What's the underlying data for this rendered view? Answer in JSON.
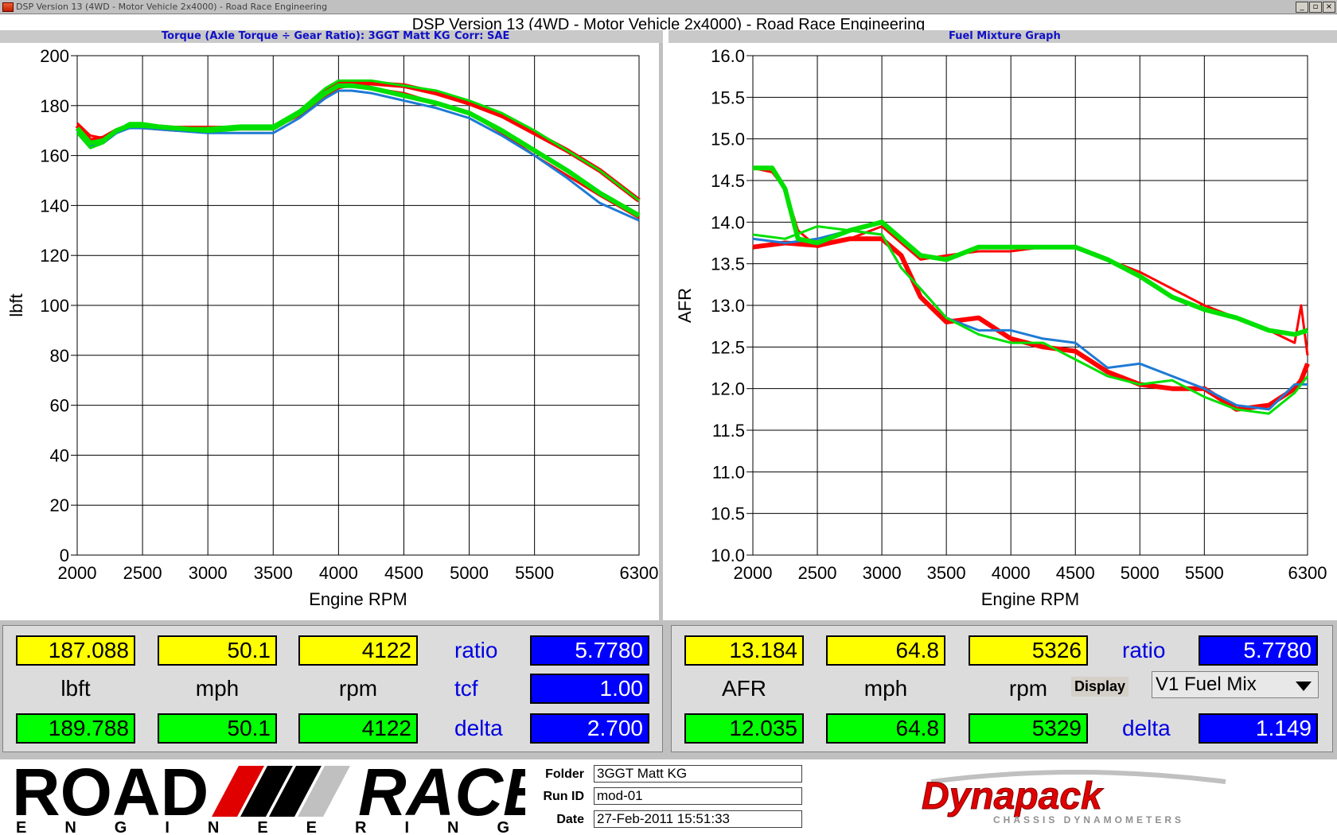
{
  "window": {
    "title": "DSP Version 13 (4WD - Motor Vehicle 2x4000) - Road Race Engineering",
    "app_title": "DSP Version 13 (4WD - Motor Vehicle 2x4000) - Road Race Engineering",
    "controls": [
      "_",
      "▫",
      "×"
    ]
  },
  "left_chart": {
    "header_title": "Torque (Axle Torque ÷ Gear Ratio): 3GGT Matt KG",
    "header_corr": "Corr: SAE",
    "xlabel": "Engine RPM",
    "ylabel": "lbft"
  },
  "right_chart": {
    "header_title": "Fuel Mixture Graph",
    "xlabel": "Engine RPM",
    "ylabel": "AFR"
  },
  "chart_data": [
    {
      "type": "line",
      "title": "Torque (Axle Torque ÷ Gear Ratio): 3GGT Matt KG",
      "xlabel": "Engine RPM",
      "ylabel": "lbft",
      "xlim": [
        2000,
        6300
      ],
      "ylim": [
        0,
        200
      ],
      "xticks": [
        "2000",
        "2500",
        "3000",
        "3500",
        "4000",
        "4500",
        "5000",
        "5500",
        "6300"
      ],
      "yticks": [
        "0",
        "20",
        "40",
        "60",
        "80",
        "100",
        "120",
        "140",
        "160",
        "180",
        "200"
      ],
      "grid": true,
      "series": [
        {
          "color": "#ff0000",
          "x": [
            2000,
            2100,
            2200,
            2300,
            2400,
            2500,
            2750,
            3000,
            3250,
            3500,
            3700,
            3900,
            4000,
            4100,
            4250,
            4500,
            4750,
            5000,
            5250,
            5500,
            5750,
            6000,
            6300
          ],
          "y": [
            173,
            168,
            167,
            170,
            172,
            171,
            170,
            170,
            171,
            171,
            176,
            184,
            187,
            188,
            187,
            185,
            181,
            177,
            169,
            160,
            152,
            144,
            135
          ]
        },
        {
          "color": "#ff0000",
          "x": [
            2000,
            2100,
            2200,
            2300,
            2400,
            2500,
            2750,
            3000,
            3250,
            3500,
            3700,
            3900,
            4000,
            4100,
            4250,
            4500,
            4750,
            5000,
            5250,
            5500,
            5750,
            6000,
            6300
          ],
          "y": [
            172,
            166,
            167,
            170,
            172,
            172,
            171,
            171,
            171,
            171,
            177,
            186,
            189,
            189,
            189,
            188,
            185,
            181,
            176,
            169,
            162,
            154,
            142
          ]
        },
        {
          "color": "#1e7ad4",
          "x": [
            2000,
            2100,
            2200,
            2300,
            2400,
            2500,
            2750,
            3000,
            3250,
            3500,
            3700,
            3900,
            4000,
            4100,
            4250,
            4500,
            4750,
            5000,
            5250,
            5500,
            5750,
            6000,
            6300
          ],
          "y": [
            170,
            164,
            165,
            169,
            171,
            171,
            170,
            169,
            169,
            169,
            175,
            183,
            186,
            186,
            185,
            182,
            179,
            175,
            168,
            160,
            151,
            141,
            134
          ]
        },
        {
          "color": "#00e000",
          "x": [
            2000,
            2100,
            2200,
            2300,
            2400,
            2500,
            2750,
            3000,
            3250,
            3500,
            3700,
            3900,
            4000,
            4100,
            4250,
            4500,
            4750,
            5000,
            5250,
            5500,
            5750,
            6000,
            6300
          ],
          "y": [
            171,
            165,
            166,
            170,
            172,
            172,
            171,
            170,
            171,
            171,
            177,
            185,
            188,
            188,
            187,
            184,
            181,
            177,
            170,
            162,
            154,
            145,
            136
          ]
        },
        {
          "color": "#00e000",
          "x": [
            2000,
            2100,
            2200,
            2300,
            2400,
            2500,
            2750,
            3000,
            3250,
            3500,
            3700,
            3900,
            4000,
            4100,
            4250,
            4500,
            4750,
            5000,
            5250,
            5500,
            5750,
            6000,
            6300
          ],
          "y": [
            169,
            163,
            165,
            170,
            173,
            173,
            171,
            171,
            172,
            172,
            178,
            187,
            190,
            190,
            190,
            188,
            186,
            182,
            177,
            170,
            162,
            154,
            142
          ]
        }
      ]
    },
    {
      "type": "line",
      "title": "Fuel Mixture Graph",
      "xlabel": "Engine RPM",
      "ylabel": "AFR",
      "xlim": [
        2000,
        6300
      ],
      "ylim": [
        10.0,
        16.0
      ],
      "xticks": [
        "2000",
        "2500",
        "3000",
        "3500",
        "4000",
        "4500",
        "5000",
        "5500",
        "6300"
      ],
      "yticks": [
        "10.0",
        "10.5",
        "11.0",
        "11.5",
        "12.0",
        "12.5",
        "13.0",
        "13.5",
        "14.0",
        "14.5",
        "15.0",
        "15.5",
        "16.0"
      ],
      "grid": true,
      "series": [
        {
          "color": "#ff0000",
          "x": [
            2000,
            2150,
            2250,
            2350,
            2500,
            2750,
            3000,
            3150,
            3300,
            3500,
            3750,
            4000,
            4250,
            4500,
            4750,
            5000,
            5250,
            5500,
            5750,
            6000,
            6200,
            6250,
            6300
          ],
          "y": [
            14.65,
            14.6,
            14.4,
            13.9,
            13.7,
            13.8,
            13.95,
            13.75,
            13.55,
            13.6,
            13.65,
            13.65,
            13.7,
            13.7,
            13.55,
            13.4,
            13.2,
            13.0,
            12.85,
            12.7,
            12.55,
            13.0,
            12.4
          ]
        },
        {
          "color": "#ff0000",
          "x": [
            2000,
            2250,
            2500,
            2750,
            3000,
            3150,
            3300,
            3500,
            3750,
            4000,
            4250,
            4500,
            4750,
            5000,
            5250,
            5500,
            5750,
            6000,
            6200,
            6250,
            6300
          ],
          "y": [
            13.7,
            13.75,
            13.72,
            13.8,
            13.8,
            13.6,
            13.1,
            12.8,
            12.85,
            12.6,
            12.5,
            12.45,
            12.2,
            12.05,
            12.0,
            12.0,
            11.75,
            11.8,
            12.0,
            12.1,
            12.3
          ]
        },
        {
          "color": "#1e7ad4",
          "x": [
            2000,
            2250,
            2500,
            2750,
            3000,
            3150,
            3300,
            3500,
            3750,
            4000,
            4250,
            4500,
            4750,
            5000,
            5250,
            5500,
            5750,
            6000,
            6200,
            6300
          ],
          "y": [
            13.8,
            13.75,
            13.8,
            13.9,
            13.85,
            13.45,
            13.2,
            12.85,
            12.7,
            12.7,
            12.6,
            12.55,
            12.25,
            12.3,
            12.15,
            12.0,
            11.8,
            11.75,
            12.05,
            12.05
          ]
        },
        {
          "color": "#00e000",
          "x": [
            2000,
            2150,
            2250,
            2350,
            2500,
            2750,
            3000,
            3150,
            3300,
            3500,
            3750,
            4000,
            4250,
            4500,
            4750,
            5000,
            5250,
            5500,
            5750,
            6000,
            6200,
            6300
          ],
          "y": [
            14.65,
            14.65,
            14.4,
            13.8,
            13.75,
            13.9,
            14.0,
            13.8,
            13.6,
            13.55,
            13.7,
            13.7,
            13.7,
            13.7,
            13.55,
            13.35,
            13.1,
            12.95,
            12.85,
            12.7,
            12.65,
            12.7
          ]
        },
        {
          "color": "#00e000",
          "x": [
            2000,
            2250,
            2500,
            2750,
            3000,
            3150,
            3300,
            3500,
            3750,
            4000,
            4250,
            4500,
            4750,
            5000,
            5250,
            5500,
            5750,
            6000,
            6200,
            6300
          ],
          "y": [
            13.85,
            13.8,
            13.95,
            13.9,
            13.85,
            13.45,
            13.2,
            12.85,
            12.65,
            12.55,
            12.55,
            12.35,
            12.15,
            12.05,
            12.1,
            11.9,
            11.75,
            11.7,
            11.95,
            12.15
          ]
        }
      ]
    }
  ],
  "readouts_left": {
    "torque_yellow": "187.088",
    "mph_yellow": "50.1",
    "rpm_yellow": "4122",
    "unit_torque": "lbft",
    "unit_mph": "mph",
    "unit_rpm": "rpm",
    "torque_green": "189.788",
    "mph_green": "50.1",
    "rpm_green": "4122",
    "ratio_label": "ratio",
    "ratio_value": "5.7780",
    "tcf_label": "tcf",
    "tcf_value": "1.00",
    "delta_label": "delta",
    "delta_value": "2.700"
  },
  "readouts_right": {
    "afr_yellow": "13.184",
    "mph_yellow": "64.8",
    "rpm_yellow": "5326",
    "unit_afr": "AFR",
    "unit_mph": "mph",
    "unit_rpm": "rpm",
    "afr_green": "12.035",
    "mph_green": "64.8",
    "rpm_green": "5329",
    "ratio_label": "ratio",
    "ratio_value": "5.7780",
    "display_label": "Display",
    "display_selected": "V1 Fuel Mix",
    "delta_label": "delta",
    "delta_value": "1.149"
  },
  "footer": {
    "logo_word1": "ROAD",
    "logo_word2": "RACE",
    "logo_subtitle": "ENGINEERING",
    "folder_label": "Folder",
    "folder_value": "3GGT Matt KG",
    "runid_label": "Run ID",
    "runid_value": "mod-01",
    "date_label": "Date",
    "date_value": "27-Feb-2011 15:51:33",
    "brand_name": "Dynapack",
    "brand_tagline": "CHASSIS DYNAMOMETERS"
  },
  "colors": {
    "red": "#ff0000",
    "blue": "#1e7ad4",
    "green": "#00e000",
    "readout_yellow": "#ffff00",
    "readout_green": "#00ff00",
    "readout_blue": "#0000ff"
  }
}
